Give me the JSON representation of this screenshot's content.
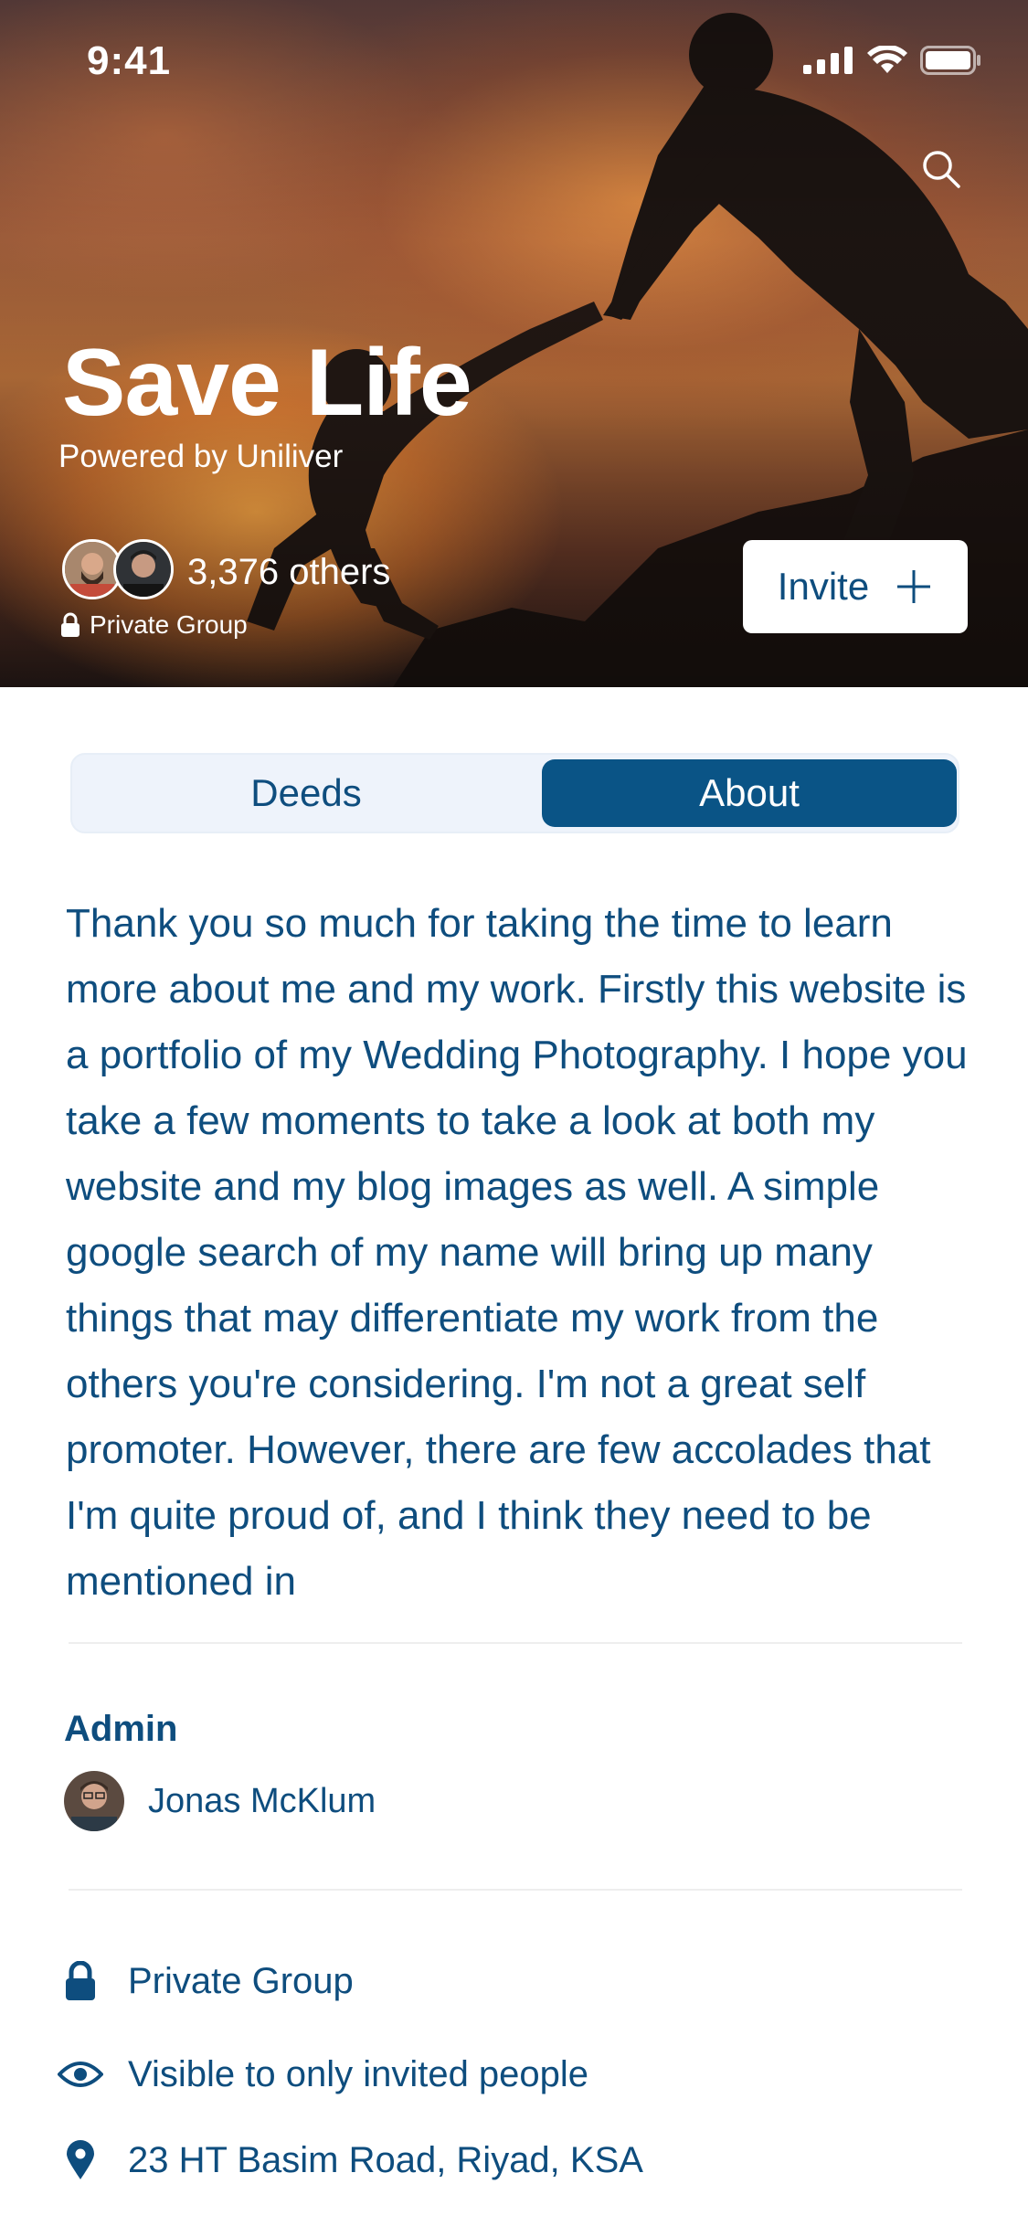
{
  "status_bar": {
    "time": "9:41"
  },
  "header": {
    "title": "Save Life",
    "subtitle": "Powered by Uniliver",
    "members_count": "3,376 others",
    "privacy_label": "Private Group",
    "invite_label": "Invite"
  },
  "tabs": [
    {
      "label": "Deeds",
      "active": false
    },
    {
      "label": "About",
      "active": true
    }
  ],
  "about": {
    "description": "Thank you so much for taking the time to learn more about me and my work. Firstly this website is a portfolio of my Wedding Photography. I hope you take a few moments to take a look at both my website and my blog images as well. A simple google search of my name will bring up many things that may differentiate my work from the others you're considering. I'm not a great self promoter. However, there are few accolades that I'm quite proud of, and I think they need to be mentioned in",
    "admin_heading": "Admin",
    "admin_name": "Jonas McKlum",
    "details": [
      {
        "icon": "lock-icon",
        "text": "Private Group"
      },
      {
        "icon": "eye-icon",
        "text": "Visible to only invited people"
      },
      {
        "icon": "location-pin-icon",
        "text": "23 HT Basim Road, Riyad, KSA"
      }
    ]
  },
  "colors": {
    "primary": "#0e4d7e",
    "active_tab": "#0a5486",
    "tab_track": "#eef3fb"
  }
}
